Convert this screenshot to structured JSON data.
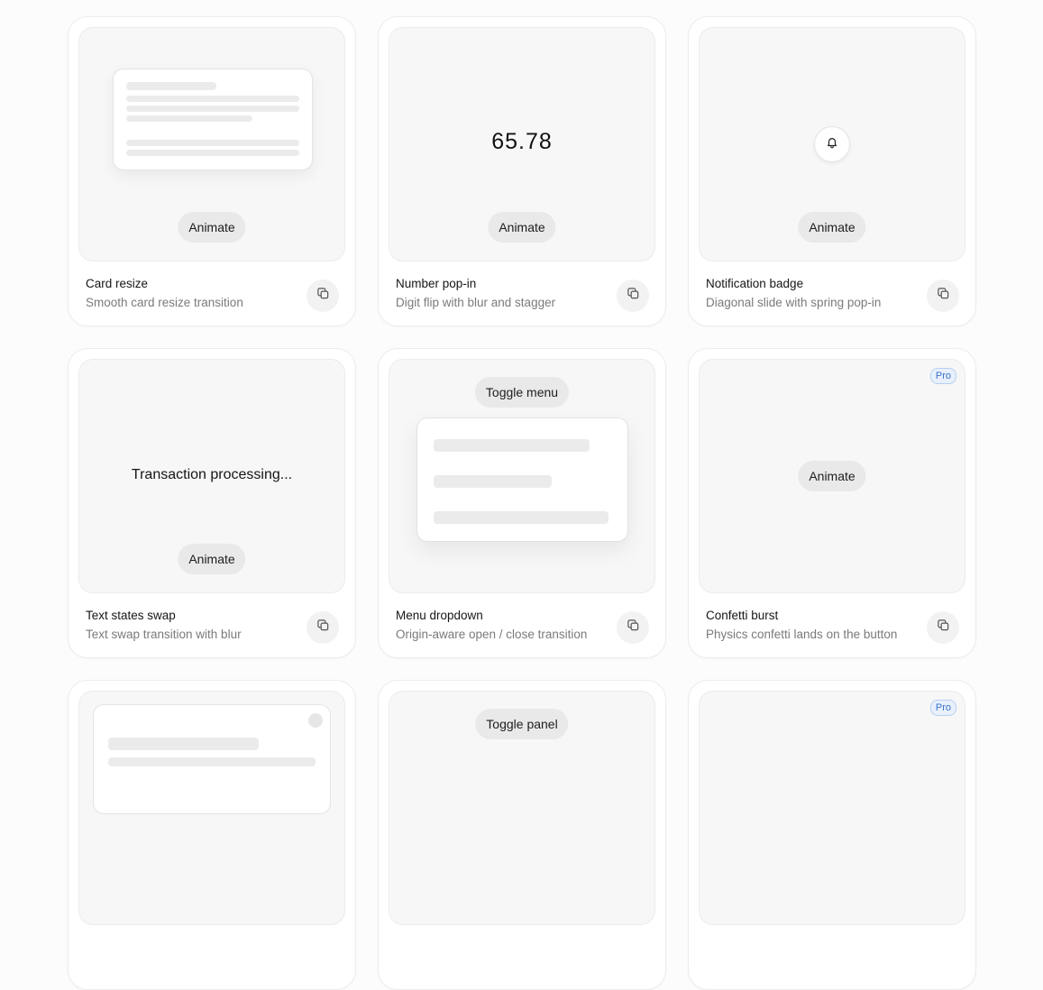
{
  "cards": [
    {
      "title": "Card resize",
      "description": "Smooth card resize transition",
      "button": "Animate"
    },
    {
      "title": "Number pop-in",
      "description": "Digit flip with blur and stagger",
      "button": "Animate",
      "number": "65.78"
    },
    {
      "title": "Notification badge",
      "description": "Diagonal slide with spring pop-in",
      "button": "Animate"
    },
    {
      "title": "Text states swap",
      "description": "Text swap transition with blur",
      "button": "Animate",
      "status_text": "Transaction processing..."
    },
    {
      "title": "Menu dropdown",
      "description": "Origin-aware open / close transition",
      "button": "Toggle menu"
    },
    {
      "title": "Confetti burst",
      "description": "Physics confetti lands on the button",
      "button": "Animate",
      "badge": "Pro"
    },
    {
      "title": "",
      "description": ""
    },
    {
      "title": "",
      "description": "",
      "button": "Toggle panel"
    },
    {
      "title": "",
      "description": "",
      "badge": "Pro"
    }
  ],
  "icons": {
    "copy": "copy-icon",
    "bell": "bell-icon"
  },
  "colors": {
    "pro_badge": "#3a73c9",
    "pro_badge_bg": "#e8f0fc"
  }
}
